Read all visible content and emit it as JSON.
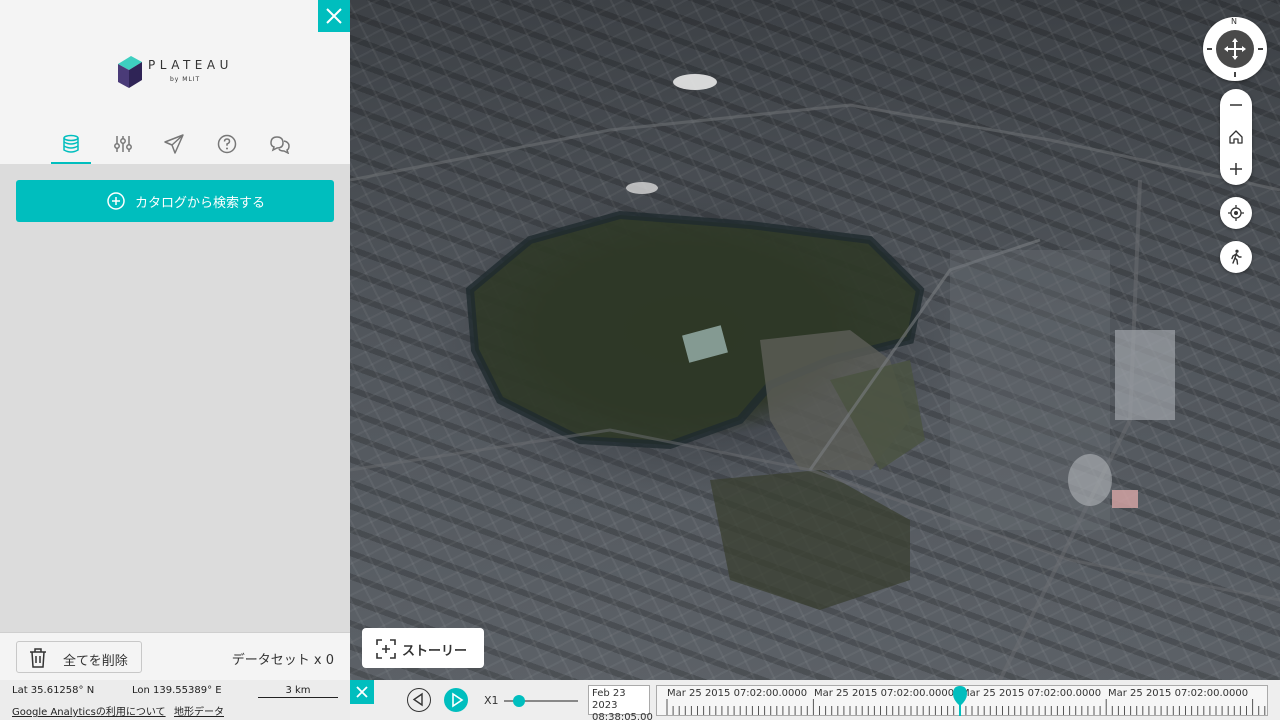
{
  "sidebar": {
    "logo": {
      "word": "PLATEAU",
      "sub": "by MLIT"
    },
    "tabs": [
      {
        "icon": "database-icon",
        "active": true
      },
      {
        "icon": "sliders-icon",
        "active": false
      },
      {
        "icon": "paper-plane-icon",
        "active": false
      },
      {
        "icon": "help-circle-icon",
        "active": false
      },
      {
        "icon": "chat-bubbles-icon",
        "active": false
      }
    ],
    "catalog_button": "カタログから検索する",
    "delete_all": "全てを削除",
    "dataset_count": "データセット x 0"
  },
  "status": {
    "lat": "Lat  35.61258° N",
    "lon": "Lon  139.55389° E",
    "scale": "3 km",
    "ga_link": "Google Analyticsの利用について",
    "terrain_link": "地形データ"
  },
  "map_controls": {
    "compass_north": "N",
    "story_button": "ストーリー"
  },
  "timeline": {
    "speed": "X1",
    "speed_fraction": 0.2,
    "current_date": "Feb 23 2023",
    "current_time": "08:38:05.00",
    "labels": [
      "Mar 25 2015 07:02:00.0000",
      "Mar 25 2015 07:02:00.0000",
      "Mar 25 2015 07:02:00.0000",
      "Mar 25 2015 07:02:00.0000"
    ]
  },
  "colors": {
    "accent": "#00bebe",
    "sidebar_bg": "#dcdcdc",
    "header_bg": "#f4f4f4"
  }
}
